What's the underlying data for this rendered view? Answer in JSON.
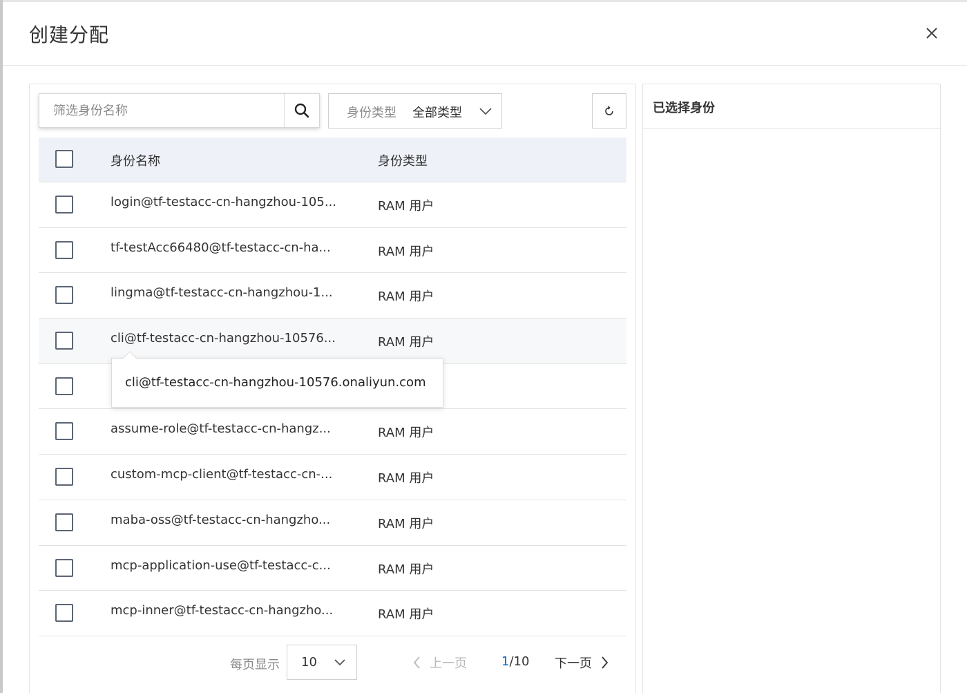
{
  "dialog": {
    "title": "创建分配"
  },
  "search": {
    "placeholder": "筛选身份名称"
  },
  "type_filter": {
    "label": "身份类型",
    "value": "全部类型"
  },
  "table": {
    "headers": {
      "name": "身份名称",
      "type": "身份类型"
    },
    "rows": [
      {
        "name": "login@tf-testacc-cn-hangzhou-105...",
        "type": "RAM 用户"
      },
      {
        "name": "tf-testAcc66480@tf-testacc-cn-ha...",
        "type": "RAM 用户"
      },
      {
        "name": "lingma@tf-testacc-cn-hangzhou-1...",
        "type": "RAM 用户"
      },
      {
        "name": "cli@tf-testacc-cn-hangzhou-10576...",
        "type": "RAM 用户"
      },
      {
        "name": "",
        "type": ""
      },
      {
        "name": "assume-role@tf-testacc-cn-hangz...",
        "type": "RAM 用户"
      },
      {
        "name": "custom-mcp-client@tf-testacc-cn-...",
        "type": "RAM 用户"
      },
      {
        "name": "maba-oss@tf-testacc-cn-hangzho...",
        "type": "RAM 用户"
      },
      {
        "name": "mcp-application-use@tf-testacc-c...",
        "type": "RAM 用户"
      },
      {
        "name": "mcp-inner@tf-testacc-cn-hangzho...",
        "type": "RAM 用户"
      }
    ]
  },
  "tooltip": {
    "text": "cli@tf-testacc-cn-hangzhou-10576.onaliyun.com"
  },
  "selected_panel": {
    "title": "已选择身份"
  },
  "pagination": {
    "page_size_label": "每页显示",
    "page_size": "10",
    "prev_label": "上一页",
    "current_page": "1",
    "total_pages": "/10",
    "next_label": "下一页"
  },
  "colors": {
    "accent": "#0064c8",
    "header_bg": "#eef1f7",
    "border": "#e3e3e3"
  }
}
